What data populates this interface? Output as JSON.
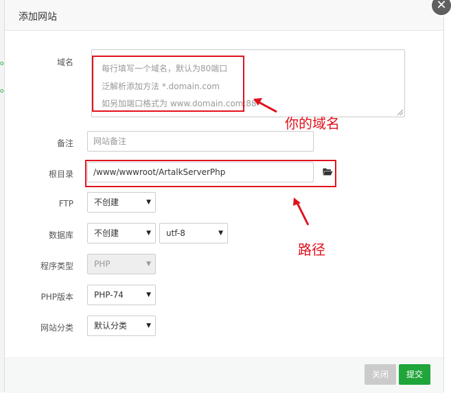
{
  "dialog": {
    "title": "添加网站",
    "close_icon": "✕"
  },
  "form": {
    "domain": {
      "label": "域名",
      "placeholder_lines": [
        "每行填写一个域名，默认为80端口",
        "泛解析添加方法 *.domain.com",
        "如另加端口格式为 www.domain.com:88"
      ]
    },
    "remark": {
      "label": "备注",
      "placeholder": "网站备注"
    },
    "root": {
      "label": "根目录",
      "value": "/www/wwwroot/ArtalkServerPhp",
      "icon": "folder-open-icon"
    },
    "ftp": {
      "label": "FTP",
      "selected": "不创建"
    },
    "database": {
      "label": "数据库",
      "selected": "不创建",
      "charset_selected": "utf-8"
    },
    "program_type": {
      "label": "程序类型",
      "selected": "PHP",
      "disabled": true
    },
    "php_version": {
      "label": "PHP版本",
      "selected": "PHP-74"
    },
    "category": {
      "label": "网站分类",
      "selected": "默认分类"
    }
  },
  "annotations": {
    "domain_note": "你的域名",
    "path_note": "路径",
    "highlight_color": "#e0111c"
  },
  "footer": {
    "close_label": "关闭",
    "submit_label": "提交",
    "submit_color": "#20a53a"
  }
}
